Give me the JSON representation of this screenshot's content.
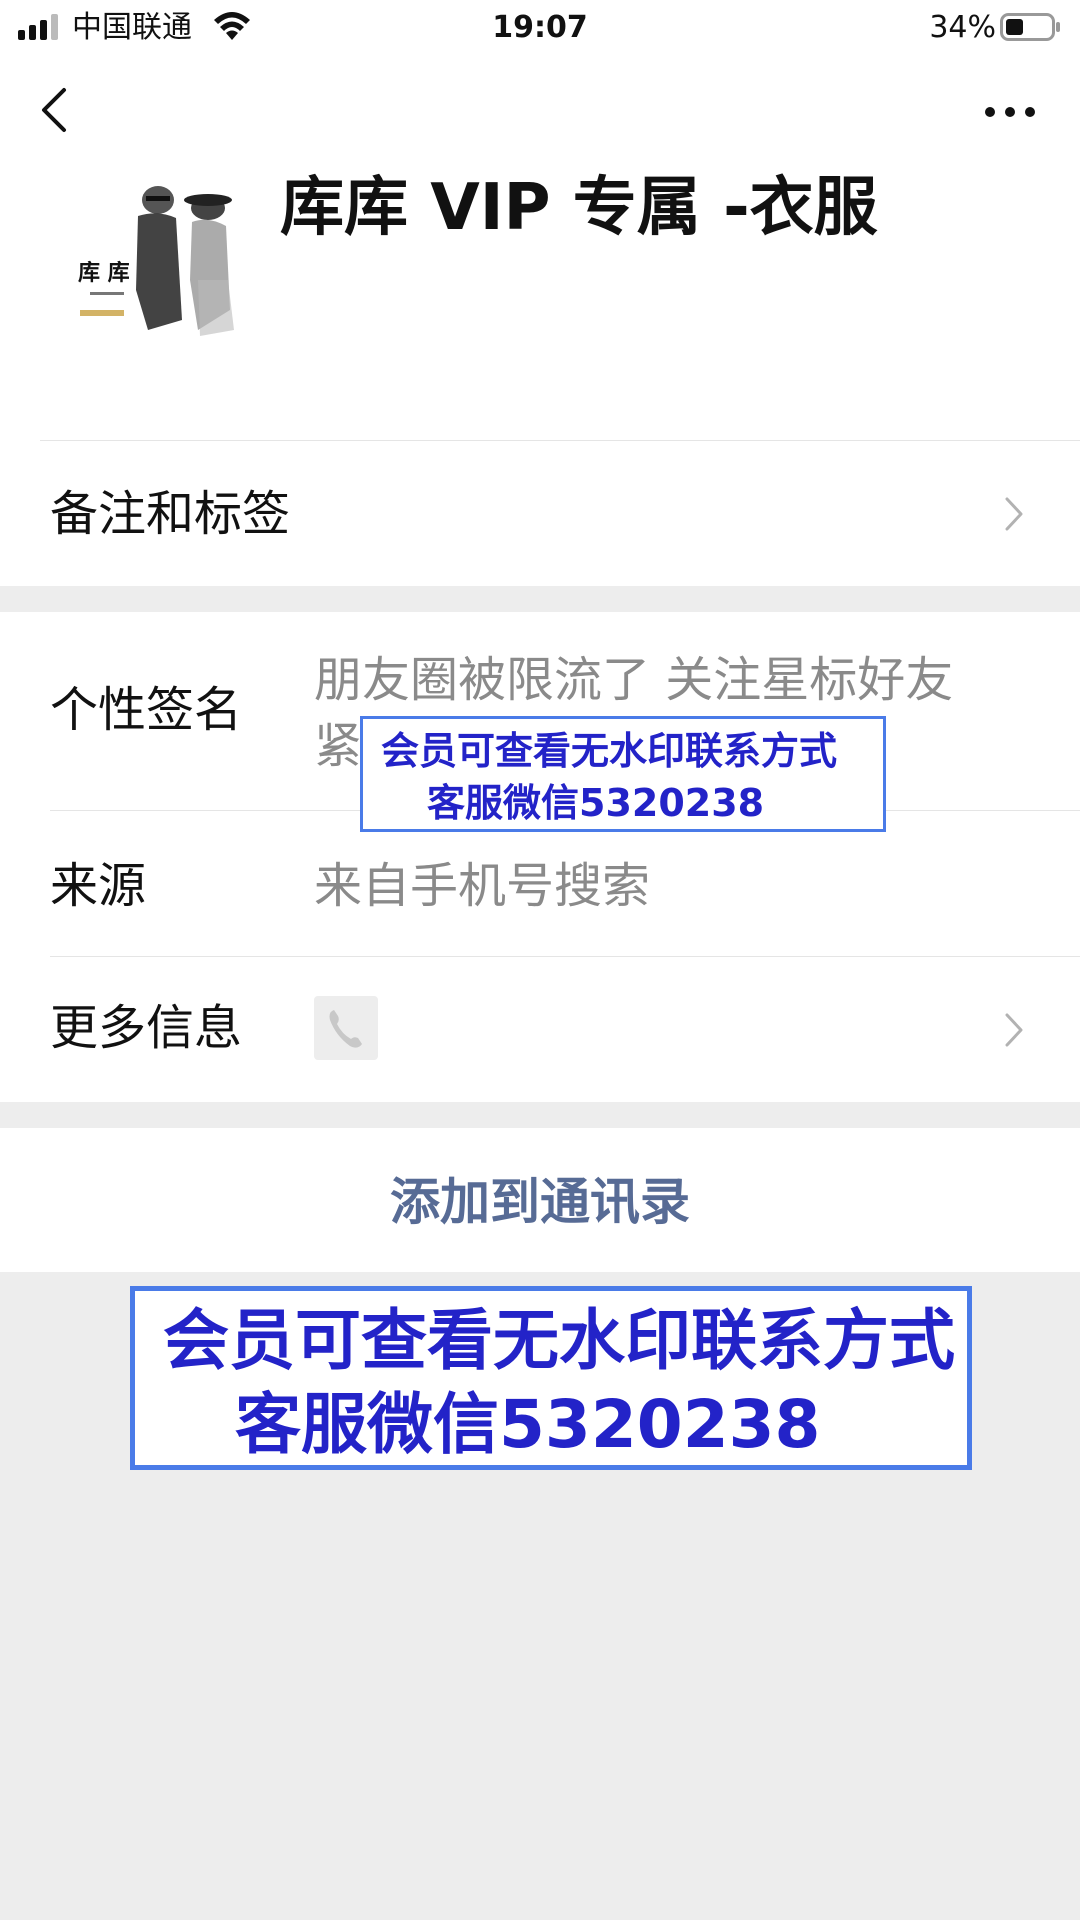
{
  "status_bar": {
    "carrier": "中国联通",
    "time": "19:07",
    "battery": "34%"
  },
  "nav": {
    "back_icon": "chevron-left-icon",
    "more_icon": "more-dots-icon"
  },
  "profile": {
    "name": "库库 VIP 专属 -衣服",
    "avatar_logo_text": "库 库"
  },
  "rows": {
    "remark": {
      "label": "备注和标签"
    },
    "signature": {
      "label": "个性签名",
      "value_line1": "朋友圈被限流了 关注星标好友",
      "value_line2": "紧"
    },
    "source": {
      "label": "来源",
      "value": "来自手机号搜索"
    },
    "more_info": {
      "label": "更多信息",
      "icon": "phone-icon"
    }
  },
  "actions": {
    "add_contact": "添加到通讯录"
  },
  "watermark": {
    "line1": "会员可查看无水印联系方式",
    "line2": "客服微信5320238"
  },
  "colors": {
    "background": "#ededed",
    "link": "#576b95",
    "watermark_text": "#2323c8",
    "watermark_border": "#4a7be8"
  }
}
